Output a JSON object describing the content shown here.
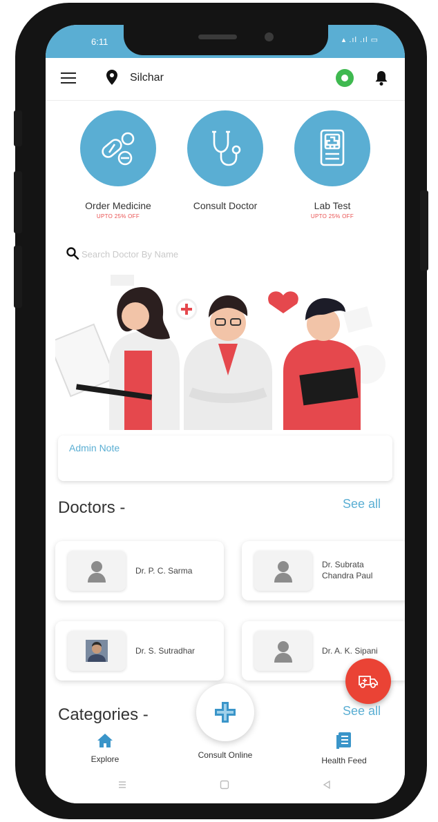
{
  "status_bar": {
    "time": "6:11",
    "indicators": "▴ .ıl .ıl  ▭"
  },
  "header": {
    "location": "Silchar",
    "icons": [
      "menu-icon",
      "location-pin-icon",
      "whatsapp-icon",
      "bell-icon"
    ]
  },
  "services": [
    {
      "label": "Order Medicine",
      "offer": "UPTO 25% OFF",
      "icon": "pills-icon"
    },
    {
      "label": "Consult Doctor",
      "offer": "",
      "icon": "stethoscope-icon"
    },
    {
      "label": "Lab Test",
      "offer": "UPTO 25% OFF",
      "icon": "lab-report-icon"
    }
  ],
  "search": {
    "placeholder": "Search Doctor By Name"
  },
  "admin_note": {
    "title": "Admin Note"
  },
  "doctors_section": {
    "title": "Doctors -",
    "see_all": "See all",
    "doctors": [
      {
        "name": "Dr. P. C. Sarma"
      },
      {
        "name_line1": "Dr. Subrata",
        "name_line2": "Chandra Paul"
      },
      {
        "name": "Dr. S. Sutradhar"
      },
      {
        "name": "Dr. A. K. Sipani"
      }
    ]
  },
  "categories_section": {
    "title": "Categories -",
    "see_all": "See all"
  },
  "bottom_nav": {
    "explore": "Explore",
    "consult_online": "Consult Online",
    "health_feed": "Health Feed"
  },
  "colors": {
    "primary": "#5aaed3",
    "accent": "#ea4335",
    "offer": "#e94f4f"
  }
}
